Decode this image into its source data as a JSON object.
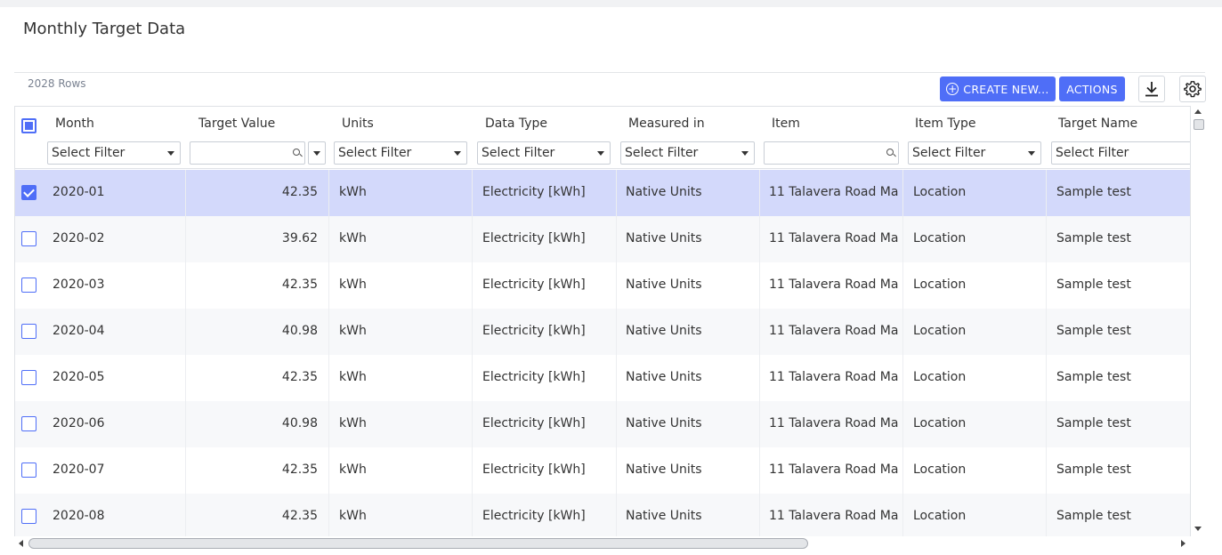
{
  "page": {
    "title": "Monthly Target Data"
  },
  "toolbar": {
    "row_count": "2028 Rows",
    "create_label": "CREATE NEW...",
    "actions_label": "ACTIONS",
    "download_icon": "download-icon",
    "settings_icon": "gear-icon"
  },
  "colors": {
    "accent": "#4f6ef7",
    "selected_row": "#d3d9fb",
    "alt_row": "#f7f8fa"
  },
  "columns": [
    {
      "label": "Month",
      "filter": "Select Filter",
      "filter_type": "select"
    },
    {
      "label": "Target Value",
      "filter": "",
      "filter_type": "search"
    },
    {
      "label": "Units",
      "filter": "Select Filter",
      "filter_type": "select"
    },
    {
      "label": "Data Type",
      "filter": "Select Filter",
      "filter_type": "select"
    },
    {
      "label": "Measured in",
      "filter": "Select Filter",
      "filter_type": "select"
    },
    {
      "label": "Item",
      "filter": "",
      "filter_type": "search"
    },
    {
      "label": "Item Type",
      "filter": "Select Filter",
      "filter_type": "select"
    },
    {
      "label": "Target Name",
      "filter": "Select Filter",
      "filter_type": "select"
    }
  ],
  "rows": [
    {
      "selected": true,
      "cells": [
        "2020-01",
        "42.35",
        "kWh",
        "Electricity [kWh]",
        "Native Units",
        "11 Talavera Road Ma...",
        "Location",
        "Sample test"
      ]
    },
    {
      "selected": false,
      "cells": [
        "2020-02",
        "39.62",
        "kWh",
        "Electricity [kWh]",
        "Native Units",
        "11 Talavera Road Ma...",
        "Location",
        "Sample test"
      ]
    },
    {
      "selected": false,
      "cells": [
        "2020-03",
        "42.35",
        "kWh",
        "Electricity [kWh]",
        "Native Units",
        "11 Talavera Road Ma...",
        "Location",
        "Sample test"
      ]
    },
    {
      "selected": false,
      "cells": [
        "2020-04",
        "40.98",
        "kWh",
        "Electricity [kWh]",
        "Native Units",
        "11 Talavera Road Ma...",
        "Location",
        "Sample test"
      ]
    },
    {
      "selected": false,
      "cells": [
        "2020-05",
        "42.35",
        "kWh",
        "Electricity [kWh]",
        "Native Units",
        "11 Talavera Road Ma...",
        "Location",
        "Sample test"
      ]
    },
    {
      "selected": false,
      "cells": [
        "2020-06",
        "40.98",
        "kWh",
        "Electricity [kWh]",
        "Native Units",
        "11 Talavera Road Ma...",
        "Location",
        "Sample test"
      ]
    },
    {
      "selected": false,
      "cells": [
        "2020-07",
        "42.35",
        "kWh",
        "Electricity [kWh]",
        "Native Units",
        "11 Talavera Road Ma...",
        "Location",
        "Sample test"
      ]
    },
    {
      "selected": false,
      "cells": [
        "2020-08",
        "42.35",
        "kWh",
        "Electricity [kWh]",
        "Native Units",
        "11 Talavera Road Ma...",
        "Location",
        "Sample test"
      ]
    }
  ]
}
